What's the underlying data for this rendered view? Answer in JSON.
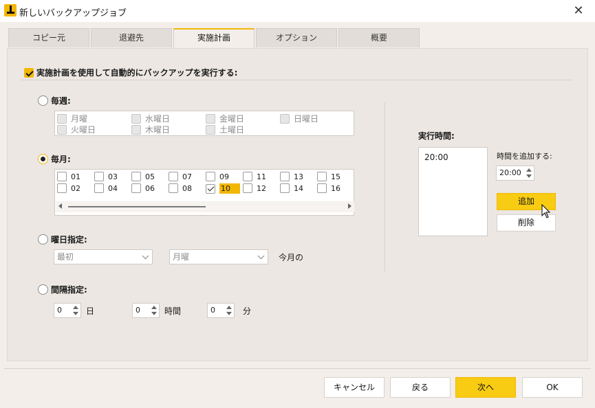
{
  "window": {
    "title": "新しいバックアップジョブ"
  },
  "tabs": [
    {
      "label": "コピー元"
    },
    {
      "label": "退避先"
    },
    {
      "label": "実施計画",
      "active": true
    },
    {
      "label": "オプション"
    },
    {
      "label": "概要"
    }
  ],
  "schedule": {
    "enable_label": "実施計画を使用して自動的にバックアップを実行する:",
    "enabled": true,
    "weekly": {
      "label": "毎週:",
      "selected": false,
      "days": [
        "月曜",
        "水曜日",
        "金曜日",
        "日曜日",
        "火曜日",
        "木曜日",
        "土曜日"
      ]
    },
    "monthly": {
      "label": "毎月:",
      "selected": true,
      "dates": [
        "01",
        "03",
        "05",
        "07",
        "09",
        "11",
        "13",
        "15",
        "02",
        "04",
        "06",
        "08",
        "10",
        "12",
        "14",
        "16"
      ],
      "checked": [
        "10"
      ]
    },
    "weekday": {
      "label": "曜日指定:",
      "selected": false,
      "order_value": "最初",
      "day_value": "月曜",
      "suffix": "今月の"
    },
    "interval": {
      "label": "間隔指定:",
      "selected": false,
      "days_value": "0",
      "days_unit": "日",
      "hours_value": "0",
      "hours_unit": "時間",
      "minutes_value": "0",
      "minutes_unit": "分"
    }
  },
  "run_times": {
    "label": "実行時間:",
    "items": [
      "20:00"
    ],
    "add_time_label": "時間を追加する:",
    "add_time_value": "20:00",
    "add_button": "追加",
    "delete_button": "削除"
  },
  "footer": {
    "cancel": "キャンセル",
    "back": "戻る",
    "next": "次へ",
    "ok": "OK"
  },
  "colors": {
    "accent": "#f2b705",
    "background": "#f3eee9"
  }
}
